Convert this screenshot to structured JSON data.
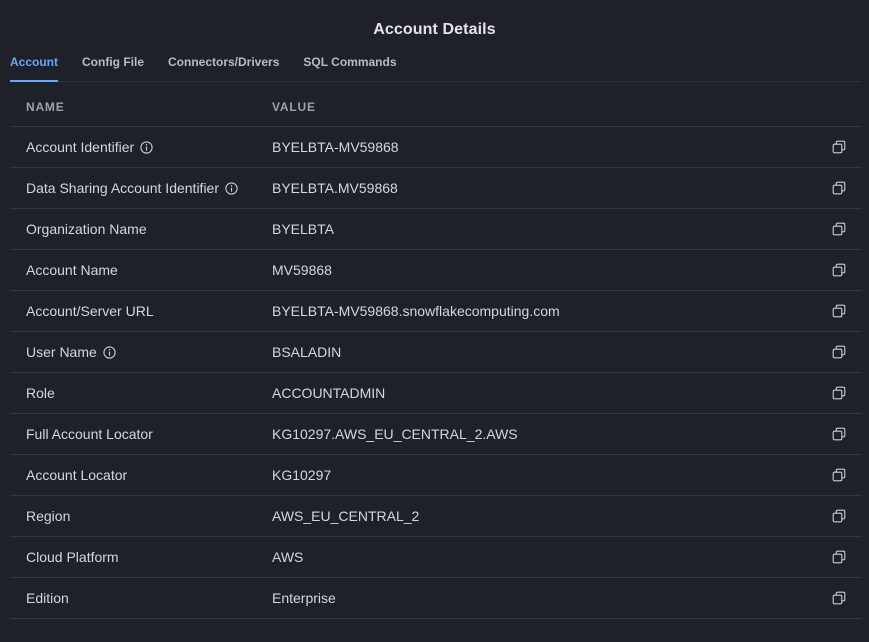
{
  "title": "Account Details",
  "tabs": [
    {
      "label": "Account",
      "active": true
    },
    {
      "label": "Config File",
      "active": false
    },
    {
      "label": "Connectors/Drivers",
      "active": false
    },
    {
      "label": "SQL Commands",
      "active": false
    }
  ],
  "table": {
    "headers": {
      "name": "NAME",
      "value": "VALUE"
    },
    "rows": [
      {
        "name": "Account Identifier",
        "value": "BYELBTA-MV59868",
        "info": true
      },
      {
        "name": "Data Sharing Account Identifier",
        "value": "BYELBTA.MV59868",
        "info": true
      },
      {
        "name": "Organization Name",
        "value": "BYELBTA",
        "info": false
      },
      {
        "name": "Account Name",
        "value": "MV59868",
        "info": false
      },
      {
        "name": "Account/Server URL",
        "value": "BYELBTA-MV59868.snowflakecomputing.com",
        "info": false
      },
      {
        "name": "User Name",
        "value": "BSALADIN",
        "info": true
      },
      {
        "name": "Role",
        "value": "ACCOUNTADMIN",
        "info": false
      },
      {
        "name": "Full Account Locator",
        "value": "KG10297.AWS_EU_CENTRAL_2.AWS",
        "info": false
      },
      {
        "name": "Account Locator",
        "value": "KG10297",
        "info": false
      },
      {
        "name": "Region",
        "value": "AWS_EU_CENTRAL_2",
        "info": false
      },
      {
        "name": "Cloud Platform",
        "value": "AWS",
        "info": false
      },
      {
        "name": "Edition",
        "value": "Enterprise",
        "info": false
      }
    ]
  },
  "colors": {
    "background": "#1e2228",
    "accent": "#63a8ff",
    "text": "#d4d7dc",
    "muted": "#9da2aa",
    "divider": "#323740"
  },
  "icons": {
    "info": "info-icon",
    "copy": "copy-icon"
  }
}
